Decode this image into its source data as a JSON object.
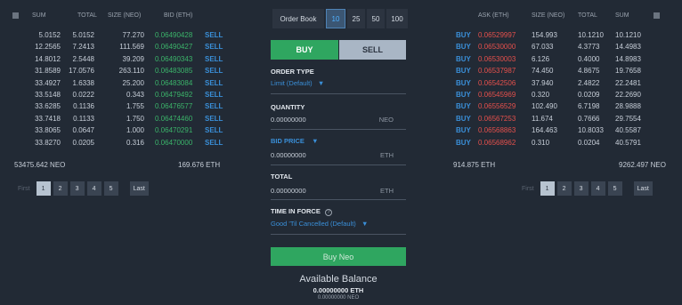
{
  "bids": {
    "headers": {
      "sum": "SUM",
      "total": "TOTAL",
      "size": "SIZE (NEO)",
      "bid": "BID (ETH)"
    },
    "rows": [
      {
        "sum": "5.0152",
        "total": "5.0152",
        "size": "77.270",
        "price": "0.06490428",
        "action": "SELL"
      },
      {
        "sum": "12.2565",
        "total": "7.2413",
        "size": "111.569",
        "price": "0.06490427",
        "action": "SELL"
      },
      {
        "sum": "14.8012",
        "total": "2.5448",
        "size": "39.209",
        "price": "0.06490343",
        "action": "SELL"
      },
      {
        "sum": "31.8589",
        "total": "17.0576",
        "size": "263.110",
        "price": "0.06483085",
        "action": "SELL"
      },
      {
        "sum": "33.4927",
        "total": "1.6338",
        "size": "25.200",
        "price": "0.06483084",
        "action": "SELL"
      },
      {
        "sum": "33.5148",
        "total": "0.0222",
        "size": "0.343",
        "price": "0.06479492",
        "action": "SELL"
      },
      {
        "sum": "33.6285",
        "total": "0.1136",
        "size": "1.755",
        "price": "0.06476577",
        "action": "SELL"
      },
      {
        "sum": "33.7418",
        "total": "0.1133",
        "size": "1.750",
        "price": "0.06474460",
        "action": "SELL"
      },
      {
        "sum": "33.8065",
        "total": "0.0647",
        "size": "1.000",
        "price": "0.06470291",
        "action": "SELL"
      },
      {
        "sum": "33.8270",
        "total": "0.0205",
        "size": "0.316",
        "price": "0.06470000",
        "action": "SELL"
      }
    ],
    "total_neo": "53475.642 NEO",
    "total_eth": "169.676 ETH",
    "pager": {
      "first": "First",
      "pages": [
        "1",
        "2",
        "3",
        "4",
        "5"
      ],
      "last": "Last"
    }
  },
  "asks": {
    "headers": {
      "ask": "ASK (ETH)",
      "size": "SIZE (NEO)",
      "total": "TOTAL",
      "sum": "SUM"
    },
    "rows": [
      {
        "action": "BUY",
        "price": "0.06529997",
        "size": "154.993",
        "total": "10.1210",
        "sum": "10.1210"
      },
      {
        "action": "BUY",
        "price": "0.06530000",
        "size": "67.033",
        "total": "4.3773",
        "sum": "14.4983"
      },
      {
        "action": "BUY",
        "price": "0.06530003",
        "size": "6.126",
        "total": "0.4000",
        "sum": "14.8983"
      },
      {
        "action": "BUY",
        "price": "0.06537987",
        "size": "74.450",
        "total": "4.8675",
        "sum": "19.7658"
      },
      {
        "action": "BUY",
        "price": "0.06542506",
        "size": "37.940",
        "total": "2.4822",
        "sum": "22.2481"
      },
      {
        "action": "BUY",
        "price": "0.06545969",
        "size": "0.320",
        "total": "0.0209",
        "sum": "22.2690"
      },
      {
        "action": "BUY",
        "price": "0.06556529",
        "size": "102.490",
        "total": "6.7198",
        "sum": "28.9888"
      },
      {
        "action": "BUY",
        "price": "0.06567253",
        "size": "11.674",
        "total": "0.7666",
        "sum": "29.7554"
      },
      {
        "action": "BUY",
        "price": "0.06568863",
        "size": "164.463",
        "total": "10.8033",
        "sum": "40.5587"
      },
      {
        "action": "BUY",
        "price": "0.06568962",
        "size": "0.310",
        "total": "0.0204",
        "sum": "40.5791"
      }
    ],
    "total_eth": "914.875 ETH",
    "total_neo": "9262.497 NEO",
    "pager": {
      "first": "First",
      "pages": [
        "1",
        "2",
        "3",
        "4",
        "5"
      ],
      "last": "Last"
    }
  },
  "toolbar": {
    "order_book": "Order Book",
    "depths": [
      "10",
      "25",
      "50",
      "100"
    ],
    "selected_depth": "10"
  },
  "form": {
    "buy_tab": "BUY",
    "sell_tab": "SELL",
    "order_type_label": "ORDER TYPE",
    "order_type_value": "Limit (Default)",
    "quantity_label": "QUANTITY",
    "quantity_value": "0.00000000",
    "quantity_unit": "NEO",
    "bid_price_label": "BID PRICE",
    "bid_price_value": "0.00000000",
    "bid_price_unit": "ETH",
    "total_label": "TOTAL",
    "total_value": "0.00000000",
    "total_unit": "ETH",
    "tif_label": "TIME IN FORCE",
    "tif_help": "?",
    "tif_value": "Good 'Til Cancelled (Default)",
    "submit": "Buy Neo"
  },
  "balance": {
    "title": "Available Balance",
    "eth": "0.00000000  ETH",
    "neo": "0.00000000  NEO"
  },
  "colors": {
    "bg": "#222a35",
    "green": "#3bb46a",
    "red": "#e5504c",
    "blue": "#3a8fd8"
  }
}
